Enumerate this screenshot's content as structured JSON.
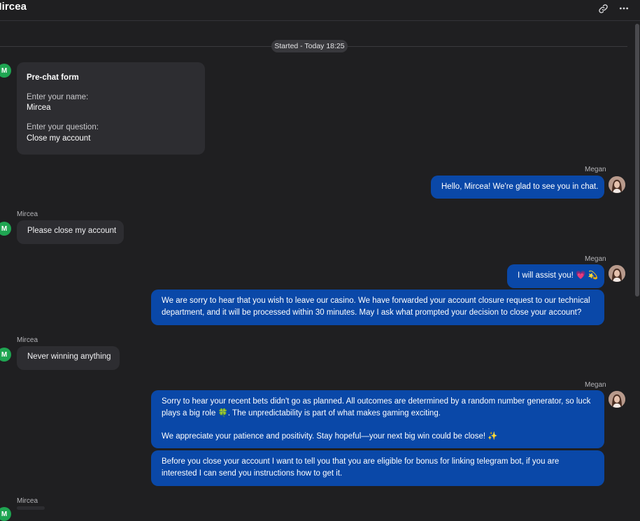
{
  "header": {
    "title": "Mircea",
    "link_icon": "link-icon",
    "more_icon": "more-horizontal-icon"
  },
  "timeline": {
    "started_label": "Started - Today 18:25"
  },
  "prechat_form": {
    "title": "Pre-chat form",
    "name_label": "Enter your name:",
    "name_value": "Mircea",
    "question_label": "Enter your question:",
    "question_value": "Close my account"
  },
  "visitor": {
    "name": "Mircea",
    "avatar_initial": "M",
    "avatar_color": "#1fa552"
  },
  "agent": {
    "name": "Megan",
    "bubble_color": "#0a48a8"
  },
  "messages": [
    {
      "from": "agent",
      "sender": "Megan",
      "text": "Hello, Mircea! We're glad to see you in chat."
    },
    {
      "from": "visitor",
      "sender": "Mircea",
      "text": "Please close my account"
    },
    {
      "from": "agent",
      "sender": "Megan",
      "text": "I will assist you! 💗 💫"
    },
    {
      "from": "agent",
      "sender": "",
      "text": "We are sorry to hear that you wish to leave our casino. We have forwarded your account closure request to our technical department, and it will be processed within 30 minutes. May I ask what prompted your decision to close your account?"
    },
    {
      "from": "visitor",
      "sender": "Mircea",
      "text": "Never winning anything"
    },
    {
      "from": "agent",
      "sender": "Megan",
      "text_p1": "Sorry to hear your recent bets didn't go as planned. All outcomes are determined by a random number generator, so luck plays a big role 🍀. The unpredictability is part of what makes gaming exciting.",
      "text_p2": "We appreciate your patience and positivity. Stay hopeful—your next big win could be close! ✨"
    },
    {
      "from": "agent",
      "sender": "",
      "text": "Before you close your account I want to tell you that you are eligible for bonus for linking telegram bot, if you are interested I can send you instructions how to get it."
    },
    {
      "from": "visitor",
      "sender": "Mircea",
      "text": ""
    }
  ]
}
